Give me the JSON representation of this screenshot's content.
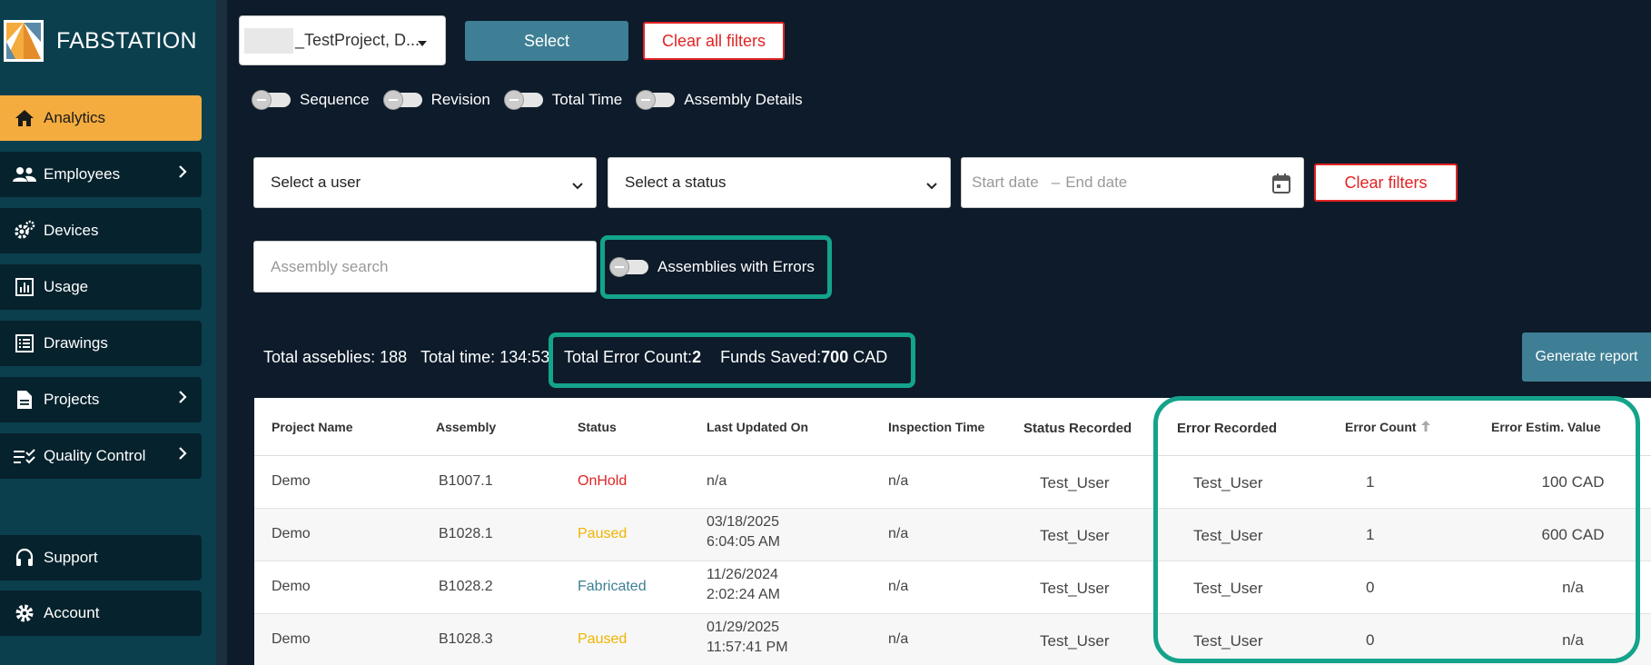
{
  "brand": {
    "name": "FABSTATION"
  },
  "sidebar": {
    "items": [
      {
        "label": "Analytics",
        "icon": "home-icon",
        "active": true,
        "has_submenu": false
      },
      {
        "label": "Employees",
        "icon": "people-icon",
        "active": false,
        "has_submenu": true
      },
      {
        "label": "Devices",
        "icon": "gears-icon",
        "active": false,
        "has_submenu": false
      },
      {
        "label": "Usage",
        "icon": "bar-chart-icon",
        "active": false,
        "has_submenu": false
      },
      {
        "label": "Drawings",
        "icon": "list-icon",
        "active": false,
        "has_submenu": false
      },
      {
        "label": "Projects",
        "icon": "document-icon",
        "active": false,
        "has_submenu": true
      },
      {
        "label": "Quality Control",
        "icon": "checklist-icon",
        "active": false,
        "has_submenu": true
      },
      {
        "label": "Support",
        "icon": "headphones-icon",
        "active": false,
        "has_submenu": false
      },
      {
        "label": "Account",
        "icon": "gear-icon",
        "active": false,
        "has_submenu": false
      }
    ]
  },
  "toolbar": {
    "project_value": "_TestProject, D...",
    "select_label": "Select",
    "clear_all_label": "Clear all filters"
  },
  "toggles": [
    {
      "label": "Sequence",
      "on": false
    },
    {
      "label": "Revision",
      "on": false
    },
    {
      "label": "Total Time",
      "on": false
    },
    {
      "label": "Assembly Details",
      "on": false
    }
  ],
  "filters": {
    "user_placeholder": "Select a user",
    "status_placeholder": "Select a status",
    "start_date_placeholder": "Start date",
    "date_separator": "–",
    "end_date_placeholder": "End date",
    "clear_label": "Clear filters",
    "assembly_search_placeholder": "Assembly search",
    "errors_toggle_label": "Assemblies with Errors"
  },
  "stats": {
    "total_assemblies_label": "Total asseblies:",
    "total_assemblies_value": "188",
    "total_time_label": "Total time:",
    "total_time_value": "134:53",
    "error_count_label": "Total Error Count:",
    "error_count_value": "2",
    "funds_saved_label": "Funds Saved:",
    "funds_saved_value": "700",
    "funds_saved_unit": "CAD"
  },
  "report_button": "Generate report",
  "highlight_color": "#14a38b",
  "table": {
    "columns": [
      "Project Name",
      "Assembly",
      "Status",
      "Last Updated On",
      "Inspection Time",
      "Status Recorded",
      "Error Recorded",
      "Error Count",
      "Error Estim. Value"
    ],
    "status_colors": {
      "OnHold": "#e02424",
      "Paused": "#f0b400",
      "Fabricated": "#3e7f95"
    },
    "rows": [
      {
        "project": "Demo",
        "assembly": "B1007.1",
        "status": "OnHold",
        "updated_1": "n/a",
        "updated_2": "",
        "inspection": "n/a",
        "status_recorded": "Test_User",
        "error_recorded": "Test_User",
        "error_count": "1",
        "error_value": "100 CAD"
      },
      {
        "project": "Demo",
        "assembly": "B1028.1",
        "status": "Paused",
        "updated_1": "03/18/2025",
        "updated_2": "6:04:05 AM",
        "inspection": "n/a",
        "status_recorded": "Test_User",
        "error_recorded": "Test_User",
        "error_count": "1",
        "error_value": "600 CAD"
      },
      {
        "project": "Demo",
        "assembly": "B1028.2",
        "status": "Fabricated",
        "updated_1": "11/26/2024",
        "updated_2": "2:02:24 AM",
        "inspection": "n/a",
        "status_recorded": "Test_User",
        "error_recorded": "Test_User",
        "error_count": "0",
        "error_value": "n/a"
      },
      {
        "project": "Demo",
        "assembly": "B1028.3",
        "status": "Paused",
        "updated_1": "01/29/2025",
        "updated_2": "11:57:41 PM",
        "inspection": "n/a",
        "status_recorded": "Test_User",
        "error_recorded": "Test_User",
        "error_count": "0",
        "error_value": "n/a"
      }
    ]
  }
}
